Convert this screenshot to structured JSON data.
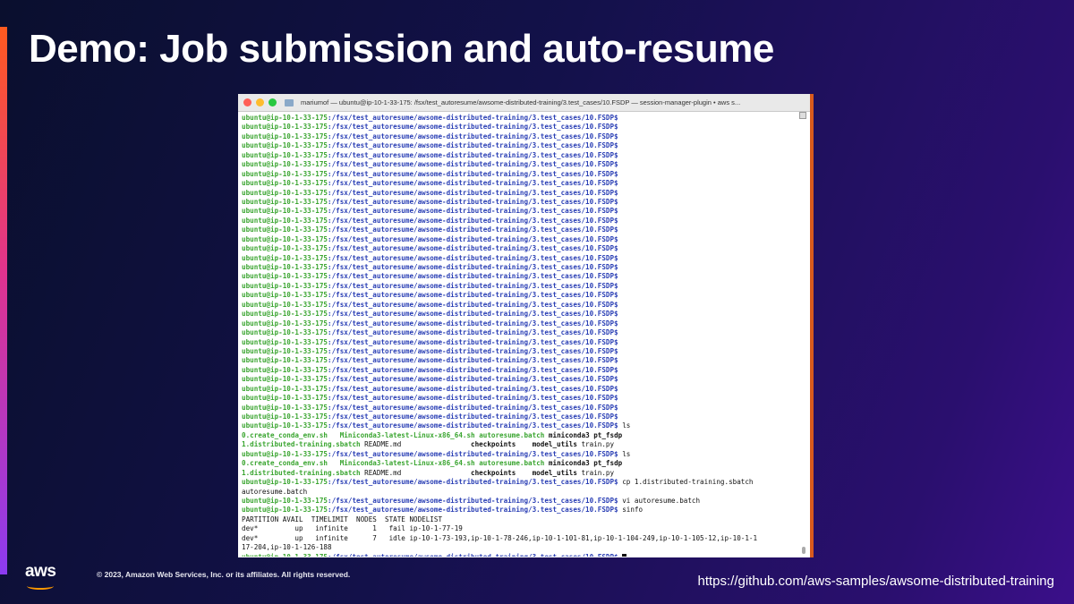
{
  "slide": {
    "title": "Demo: Job submission and auto-resume",
    "copyright": "© 2023, Amazon Web Services, Inc. or its affiliates. All rights reserved.",
    "url": "https://github.com/aws-samples/awsome-distributed-training",
    "logo_text": "aws"
  },
  "terminal": {
    "window_title": "mariumof — ubuntu@ip-10-1-33-175: /fsx/test_autoresume/awsome-distributed-training/3.test_cases/10.FSDP — session-manager-plugin • aws s...",
    "prompt_user": "ubuntu@ip-10-1-33-175",
    "prompt_path": ":/fsx/test_autoresume/awsome-distributed-training/3.test_cases/10.FSDP",
    "prompt_symbol": "$",
    "empty_prompt_count": 33,
    "ls_command": " ls",
    "ls_row1": [
      "0.create_conda_env.sh",
      "Miniconda3-latest-Linux-x86_64.sh",
      "autoresume.batch",
      "miniconda3",
      "pt_fsdp"
    ],
    "ls_row2": [
      "1.distributed-training.sbatch",
      "README.md",
      "checkpoints",
      "model_utils",
      "train.py"
    ],
    "cp_command": " cp 1.distributed-training.sbatch",
    "cp_command_wrap": "autoresume.batch",
    "vi_command": " vi autoresume.batch",
    "sinfo_command": " sinfo",
    "sinfo_header": "PARTITION AVAIL  TIMELIMIT  NODES  STATE NODELIST",
    "sinfo_row1": "dev*         up   infinite      1   fail ip-10-1-77-19",
    "sinfo_row2": "dev*         up   infinite      7   idle ip-10-1-73-193,ip-10-1-78-246,ip-10-1-101-81,ip-10-1-104-249,ip-10-1-105-12,ip-10-1-1",
    "sinfo_row2_wrap": "17-204,ip-10-1-126-188"
  },
  "colors": {
    "prompt_user": "#3aa530",
    "prompt_path": "#2a3fb5",
    "accent_orange": "#ff9900"
  }
}
